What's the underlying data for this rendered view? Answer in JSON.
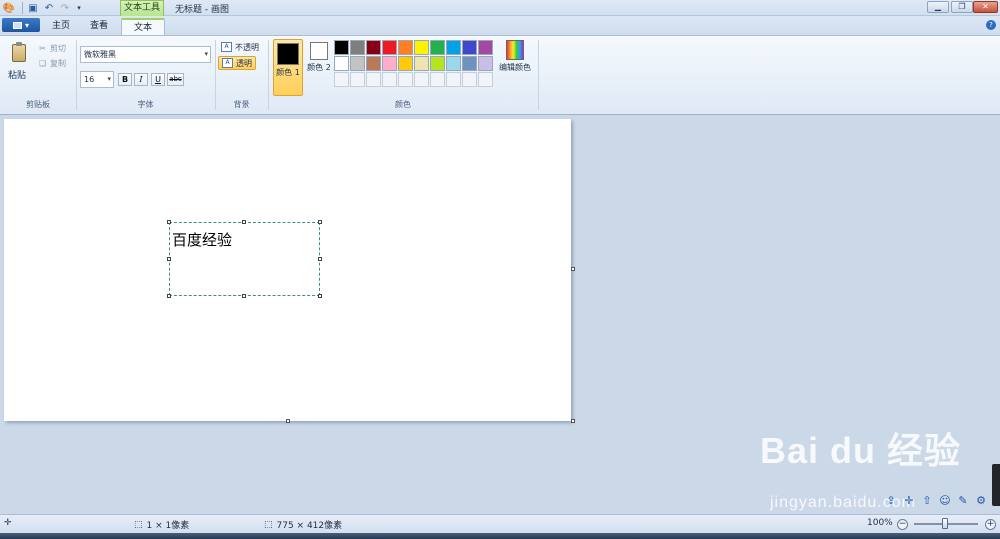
{
  "window": {
    "title": "无标题 - 画图",
    "context_tab": "文本工具"
  },
  "tabs": [
    {
      "label": "主页"
    },
    {
      "label": "查看"
    },
    {
      "label": "文本"
    }
  ],
  "ribbon": {
    "clipboard": {
      "paste_label": "粘贴",
      "cut_label": "剪切",
      "copy_label": "复制",
      "group_label": "剪贴板"
    },
    "font": {
      "family": "微软雅黑",
      "size": "16",
      "bold": "B",
      "italic": "I",
      "underline": "U",
      "strike": "abc",
      "group_label": "字体"
    },
    "background": {
      "opaque_label": "不透明",
      "transparent_label": "透明",
      "selected": "透明",
      "group_label": "背景"
    },
    "colors": {
      "color1_label": "颜色 1",
      "color1_value": "#000000",
      "color2_label": "颜色 2",
      "color2_value": "#ffffff",
      "edit_label": "编辑颜色",
      "group_label": "颜色",
      "palette": [
        "#000000",
        "#7f7f7f",
        "#880015",
        "#ed1c24",
        "#ff7f27",
        "#fff200",
        "#22b14c",
        "#00a2e8",
        "#3f48cc",
        "#a349a4",
        "#ffffff",
        "#c3c3c3",
        "#b97a57",
        "#ffaec9",
        "#ffc90e",
        "#efe4b0",
        "#b5e61d",
        "#99d9ea",
        "#7092be",
        "#c8bfe7"
      ]
    }
  },
  "canvas": {
    "text_content": "百度经验"
  },
  "watermark": {
    "brand": "Bai du 经验",
    "url": "jingyan.baidu.com"
  },
  "statusbar": {
    "cursor_pos": "",
    "selection_size": "1 × 1像素",
    "image_size": "775 × 412像素",
    "zoom": "100%"
  }
}
